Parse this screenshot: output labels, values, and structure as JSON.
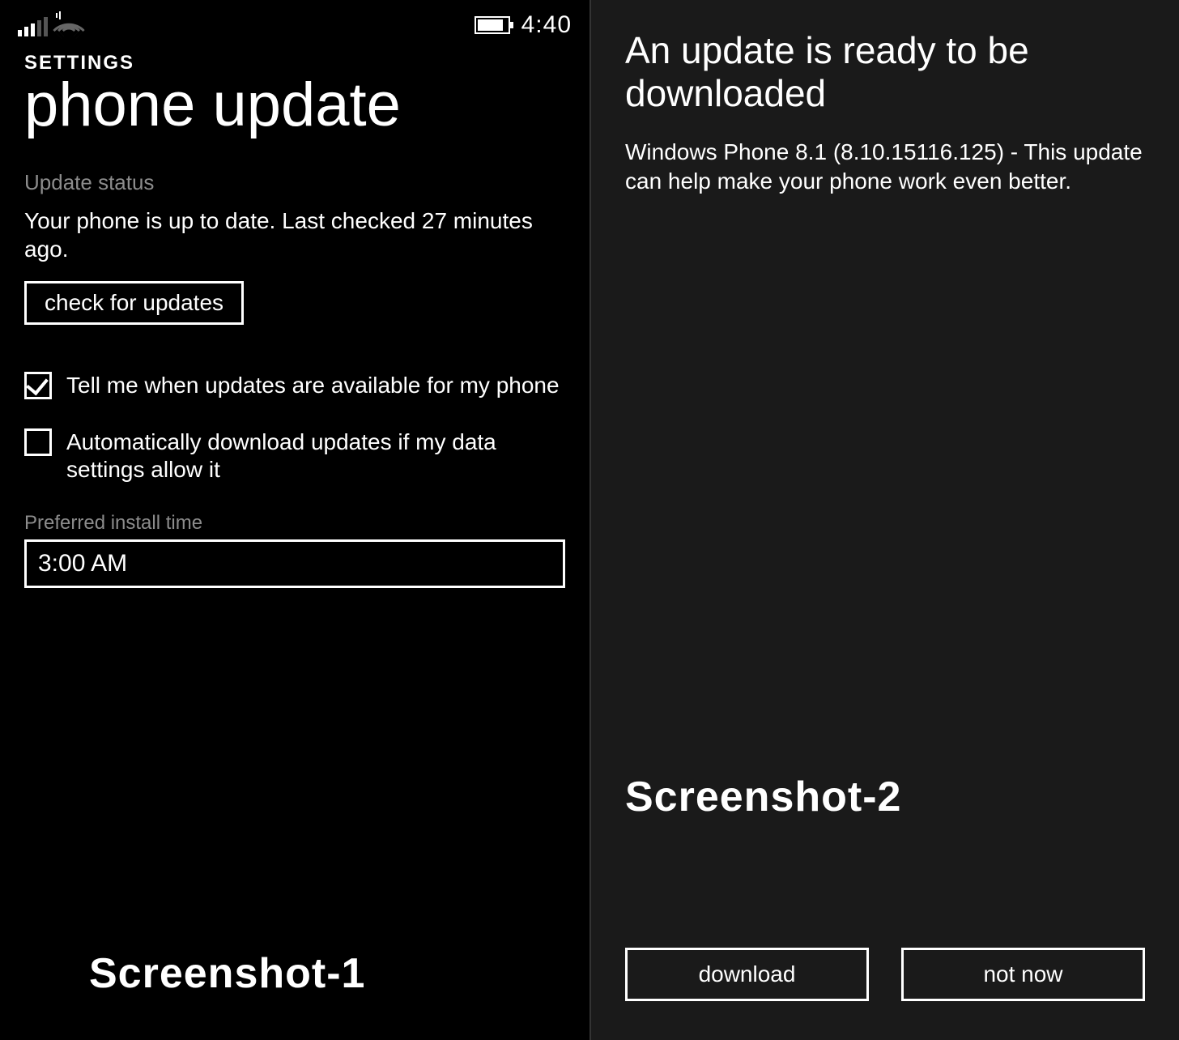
{
  "left": {
    "statusbar": {
      "time": "4:40"
    },
    "crumb": "SETTINGS",
    "title": "phone update",
    "section_label": "Update status",
    "status_text": "Your phone is up to date. Last checked 27 minutes ago.",
    "check_button": "check for updates",
    "options": [
      {
        "checked": true,
        "label": "Tell me when updates are available for my phone"
      },
      {
        "checked": false,
        "label": "Automatically download updates if my data settings allow it"
      }
    ],
    "install_time_label": "Preferred install time",
    "install_time_value": "3:00 AM",
    "caption": "Screenshot-1"
  },
  "right": {
    "title": "An update is ready to be downloaded",
    "body": "Windows Phone 8.1 (8.10.15116.125) - This update can help make your phone work even better.",
    "download_button": "download",
    "notnow_button": "not now",
    "caption": "Screenshot-2"
  }
}
